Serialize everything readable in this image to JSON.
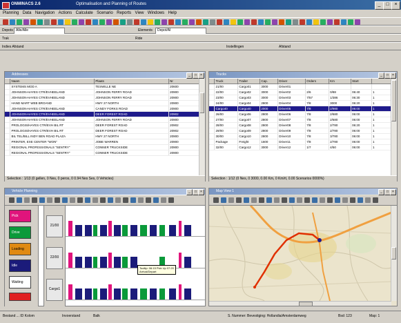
{
  "window": {
    "app_title": "ONMINACS 2.6",
    "document_title": "Optimalisation and Planning of Routes",
    "minimize": "_",
    "maximize": "□",
    "close": "×"
  },
  "menu": [
    "Planning",
    "Data",
    "Navigation",
    "Actions",
    "Calculate",
    "Scenario",
    "Reports",
    "View",
    "Windows",
    "Help"
  ],
  "toolbar2": {
    "combo1": "Alle/Alle",
    "combo2": "Depot/Al",
    "label1": "Depots",
    "label2": "Elements"
  },
  "toolbar3": {
    "label1": "Trak",
    "label2": "Ride"
  },
  "toolbar4": {
    "label1": "Indies Afstand",
    "label2": "Instellingen",
    "label3": "Afstand"
  },
  "orders_panel": {
    "title": "Addresses",
    "columns": [
      "Naam",
      "Plaats",
      "Nr"
    ],
    "rows": [
      [
        "SYSTEMS MOD A",
        "TESWILLE NE",
        "20600"
      ],
      [
        "JOHNSON-HAYES CTR/EVHEELAND",
        "JOHNSON FERRY ROAD",
        "20900"
      ],
      [
        "JOHNSON-HAYES CTR/EVHEELAND",
        "JOHNSON FERRY ROAD",
        "20900"
      ],
      [
        "HAND MART WEB BROAND",
        "HWY 27 NORTH",
        "20900"
      ],
      [
        "JOHNSON-HAYES CTR/EVHEELAND",
        "CANDY FORKS ROAD",
        "20900"
      ],
      [
        "JOHNSON-HAYES CTR/EVHEELAND",
        "DEER FOREST ROAD",
        "20902"
      ],
      [
        "JOHNSON-HAYES CTR/EVHEELAND",
        "JOHNSON FERRY ROAD",
        "20900"
      ],
      [
        "PROLOGIS/HAYES CTR/EVH BIL RT",
        "DEER FOREST ROAD",
        "20902"
      ],
      [
        "PROLOGIS/HAYES CTR/EVH BIL RT",
        "DEER FOREST ROAD",
        "20902"
      ],
      [
        "BIL TEL/BILL INDY BEN ROAD PLAZA",
        "HWY 27 NORTH",
        "20900"
      ],
      [
        "PRINTER, EXE CENTER \"WON\"",
        "JOBE WARREN",
        "20900"
      ],
      [
        "REGIONAL PROFESSIONALS \"SENTRY\"",
        "CONNER TRUCKSIDE",
        "20900"
      ],
      [
        "REGIONAL PROFESSIONALS \"SENTRY\"",
        "CONNER TRUCKSIDE",
        "20900"
      ]
    ],
    "selected_row": 5,
    "status": "Selection : 1/13 (0 gellen, 0 Nes, 0 peros, 0 0.94 Nes Ses, 0 Vehicles)"
  },
  "trucks_panel": {
    "title": "Trucks",
    "columns": [
      "Truck",
      "Trailer",
      "Cap.",
      "Driver",
      "Orders",
      "Km",
      "Start",
      ""
    ],
    "rows": [
      [
        "21/00",
        "Cargo01",
        "3000",
        "Driver01",
        "",
        "",
        "",
        ""
      ],
      [
        "22/00",
        "Cargo02",
        "3000",
        "Driver02",
        "2/6",
        "0/88",
        "06:40",
        "1"
      ],
      [
        "23/00",
        "Cargo03",
        "3000",
        "Driver03",
        "7/57",
        "1/386",
        "06:30",
        "1"
      ],
      [
        "24/00",
        "Cargo04",
        "2800",
        "Driver04",
        "7/8",
        "3000",
        "06:20",
        "1"
      ],
      [
        "Cargo40",
        "Cargo40",
        "2000",
        "Driver05",
        "7/8",
        "2/980",
        "06:00",
        "1"
      ],
      [
        "26/00",
        "Cargo06",
        "2800",
        "Driver06",
        "7/8",
        "2/680",
        "06:00",
        "1"
      ],
      [
        "27/00",
        "Cargo07",
        "2800",
        "Driver07",
        "7/8",
        "2/680",
        "06:00",
        "1"
      ],
      [
        "28/00",
        "Cargo08",
        "2800",
        "Driver08",
        "7/8",
        "2/780",
        "06:20",
        "1"
      ],
      [
        "29/00",
        "Cargo09",
        "2800",
        "Driver09",
        "7/8",
        "2/780",
        "06:00",
        "1"
      ],
      [
        "30/00",
        "Cargo10",
        "2800",
        "Driver10",
        "7/8",
        "3/780",
        "06:00",
        "1"
      ],
      [
        "Package",
        "Freight",
        "1600",
        "Driver11",
        "7/8",
        "2/780",
        "06:00",
        "1"
      ],
      [
        "32/00",
        "Cargo12",
        "3000",
        "Driver12",
        "1/7",
        "4/50",
        "06:00",
        "1"
      ]
    ],
    "selected_row": 4,
    "status": "Selection : 1/12 (0 Nes, 0 3000, 0.00 Km, 0 Km/rt, 0.00 Scenarios 0000%)"
  },
  "gantt_panel": {
    "title": "Vehicle Planning",
    "legend": [
      "Pick",
      "Drive",
      "Loading",
      "Idle",
      "Waiting"
    ],
    "legend_colors": [
      "#e0147c",
      "#0a9a3a",
      "#e08a12",
      "#1b1b7a",
      "#ffffff"
    ],
    "row_labels": [
      "21/00",
      "22/00",
      "Cargo1"
    ],
    "tooltip": [
      "Tooltip: 06:15 Pick Up 07:20",
      "Arrival/Depart"
    ]
  },
  "map_panel": {
    "title": "Map View 1",
    "route_color": "#e03000",
    "road_color": "#f0a040"
  },
  "statusbar": {
    "left": "Bestand ... ID Kolom",
    "mid1": "Invoerstand",
    "mid2": "Balk",
    "right1": "S. Nummer: Bevestiging: Hollandia/Amsterdamweg",
    "right2": "Bsd: 123",
    "right3": "Map: 1"
  }
}
